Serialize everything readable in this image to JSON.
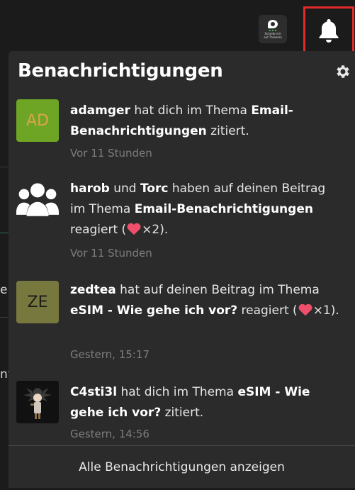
{
  "header": {
    "app_icon_label": "Schreib mir\nauf Threema",
    "bell_icon": "bell-icon",
    "highlight_color": "#e12a2a"
  },
  "background": {
    "fragment_1": "e",
    "fragment_2": "nt"
  },
  "panel": {
    "title": "Benachrichtigungen",
    "settings_icon": "gear-icon",
    "notifications": [
      {
        "avatar": "AD",
        "user": "adamger",
        "text_1": " hat dich im Thema ",
        "topic": "Email-Benachrichtigungen",
        "text_2": " zitiert.",
        "time": "Vor 11 Stunden"
      },
      {
        "avatar_icon": "group-icon",
        "user": "harob",
        "text_and": " und ",
        "user2": "Torc",
        "text_1": " haben auf deinen Beitrag im Thema ",
        "topic": "Email-Benachrichtigungen",
        "text_2": " reagiert (",
        "count": "×2",
        "text_3": ").",
        "time": "Vor 11 Stunden"
      },
      {
        "avatar": "ZE",
        "user": "zedtea",
        "text_1": " hat auf deinen Beitrag im Thema ",
        "topic": "eSIM - Wie gehe ich vor?",
        "text_2": " reagiert (",
        "count": "×1",
        "text_3": ").",
        "time": "Gestern, 15:17"
      },
      {
        "avatar_icon": "profile-image-icon",
        "user": "C4sti3l",
        "text_1": " hat dich im Thema ",
        "topic": "eSIM - Wie gehe ich vor?",
        "text_2": " zitiert.",
        "time": "Gestern, 14:56"
      }
    ],
    "footer_label": "Alle Benachrichtigungen anzeigen"
  },
  "colors": {
    "background": "#1b1b1b",
    "panel": "#2b2b2b",
    "heart": "#ef4f6b",
    "avatar_ad": "#6ea525",
    "avatar_ze": "#77783d"
  }
}
